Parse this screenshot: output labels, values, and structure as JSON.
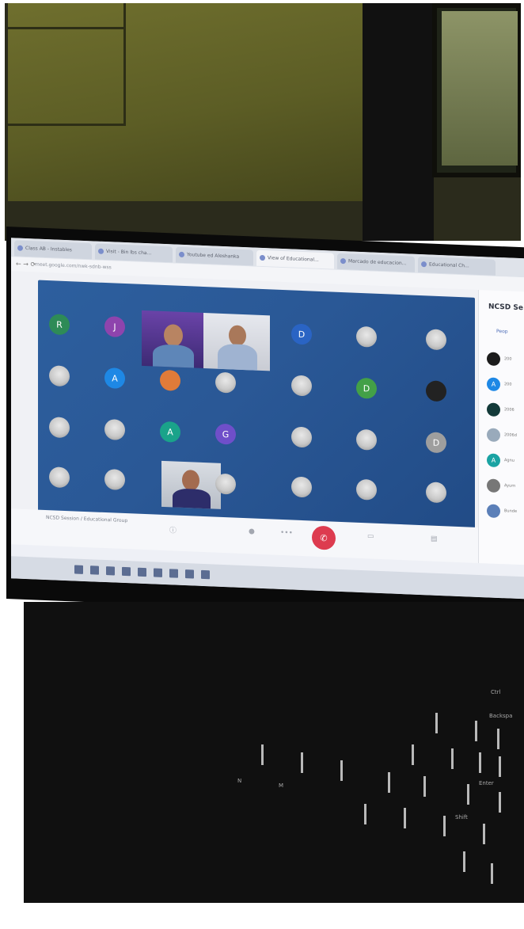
{
  "browser": {
    "tabs": [
      "Class AB - Instables",
      "Visit - Bin lbs cha...",
      "Youtube ed Aleshanka",
      "View of Educational...",
      "Marcado de educacion...",
      "Educational Ch..."
    ],
    "address": "meet.google.com/nwk-sdnb-wss"
  },
  "meeting": {
    "name": "NCSD Session / Educational Group",
    "end_call_icon": "phone-hangup-icon",
    "grid_rows": [
      [
        {
          "initial": "R",
          "color": "#2e8b57"
        },
        {
          "initial": "J",
          "color": "#8e44ad"
        },
        {
          "type": "video"
        },
        {
          "type": "video"
        },
        {
          "initial": "D",
          "color": "#2a64c4"
        },
        {
          "type": "photo"
        },
        {
          "type": "photo"
        }
      ],
      [
        {
          "type": "photo"
        },
        {
          "initial": "A",
          "color": "#1e88e5"
        },
        {
          "type": "photo",
          "color": "#e07b39"
        },
        {
          "type": "photo"
        },
        {
          "type": "photo"
        },
        {
          "initial": "D",
          "color": "#43a047"
        },
        {
          "type": "photo",
          "color": "#222"
        }
      ],
      [
        {
          "type": "photo"
        },
        {
          "type": "photo"
        },
        {
          "initial": "A",
          "color": "#1aa38a"
        },
        {
          "initial": "G",
          "color": "#6f4fc9"
        },
        {
          "type": "photo"
        },
        {
          "type": "photo"
        },
        {
          "initial": "D",
          "color": "#9e9e9e"
        }
      ],
      [
        {
          "type": "photo"
        },
        {
          "type": "photo"
        },
        {
          "type": "video"
        },
        {
          "type": "photo"
        },
        {
          "type": "photo"
        },
        {
          "type": "photo"
        },
        {
          "type": "photo"
        }
      ]
    ]
  },
  "sidebar": {
    "title": "NCSD Se",
    "tab_label": "Peop",
    "participants": [
      {
        "initial": "",
        "color": "#1c1c1c",
        "text": "200"
      },
      {
        "initial": "A",
        "color": "#1e88e5",
        "text": "200"
      },
      {
        "initial": "",
        "color": "#133a39",
        "text": "2006"
      },
      {
        "initial": "",
        "color": "#9ab",
        "text": "2006d"
      },
      {
        "initial": "A",
        "color": "#1aa3a3",
        "text": "Agnu"
      },
      {
        "initial": "",
        "color": "#777",
        "text": "Ayurn"
      },
      {
        "initial": "",
        "color": "#5b7fb8",
        "text": "Bunde"
      }
    ]
  },
  "keyboard": {
    "labels": [
      "Ctrl",
      "Backspa",
      "Enter",
      "Shift",
      "N",
      "M"
    ]
  }
}
